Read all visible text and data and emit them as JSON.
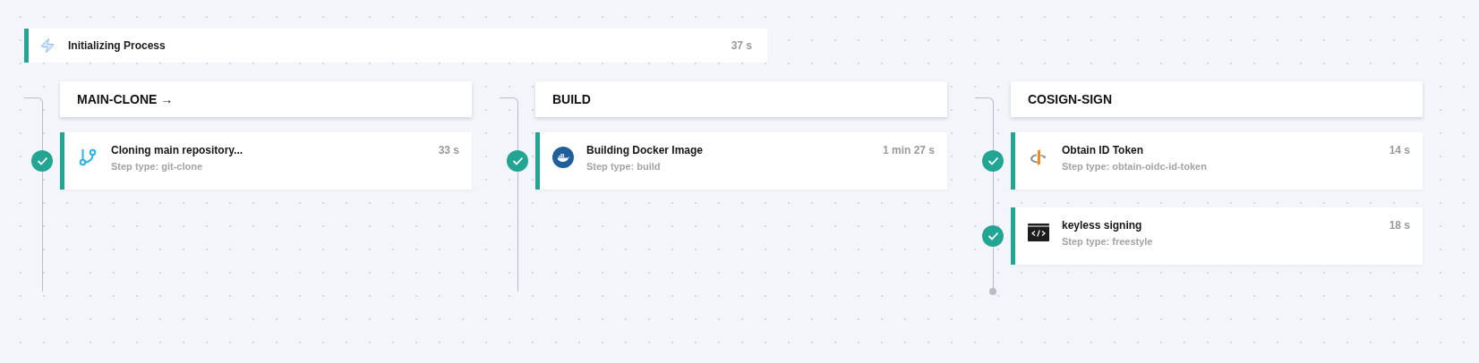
{
  "process": {
    "title": "Initializing Process",
    "duration": "37 s",
    "done": true
  },
  "stages": [
    {
      "title": "MAIN-CLONE →",
      "end_dot": false,
      "steps": [
        {
          "kind": "clone",
          "title": "Cloning main repository...",
          "type": "Step type: git-clone",
          "duration": "33 s",
          "done": true
        }
      ]
    },
    {
      "title": "BUILD",
      "end_dot": false,
      "steps": [
        {
          "kind": "build",
          "title": "Building Docker Image",
          "type": "Step type: build",
          "duration": "1 min 27 s",
          "done": true
        }
      ]
    },
    {
      "title": "COSIGN-SIGN",
      "end_dot": true,
      "steps": [
        {
          "kind": "token",
          "title": "Obtain ID Token",
          "type": "Step type: obtain-oidc-id-token",
          "duration": "14 s",
          "done": true
        },
        {
          "kind": "freestyle",
          "title": "keyless signing",
          "type": "Step type: freestyle",
          "duration": "18 s",
          "done": true
        }
      ]
    }
  ]
}
